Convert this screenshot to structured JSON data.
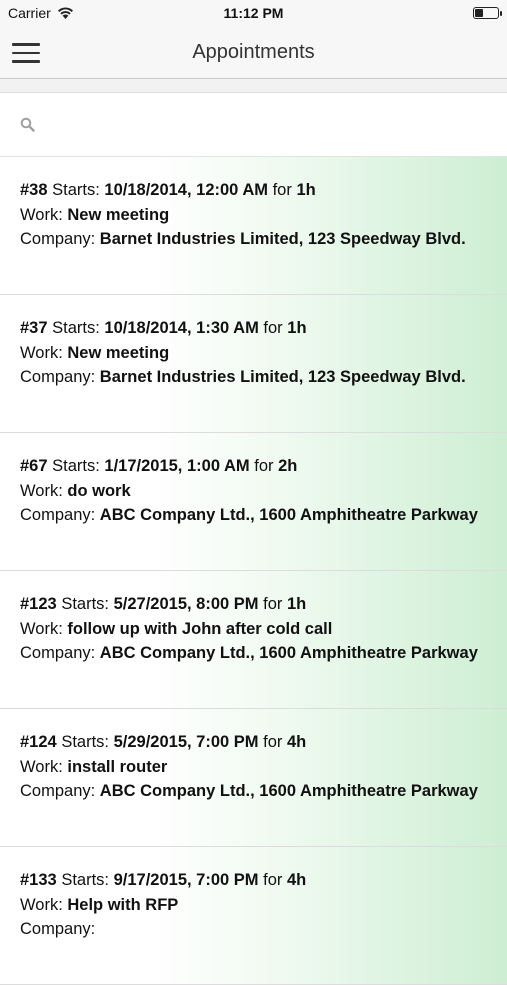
{
  "status_bar": {
    "carrier": "Carrier",
    "time": "11:12 PM",
    "battery_level": 0.35
  },
  "nav": {
    "title": "Appointments",
    "menu_icon": "hamburger-menu-icon"
  },
  "search": {
    "placeholder": "",
    "icon": "search-icon"
  },
  "labels": {
    "starts": "Starts:",
    "for": "for",
    "work": "Work:",
    "company": "Company:"
  },
  "appointments": [
    {
      "id": "#38",
      "start": "10/18/2014, 12:00 AM",
      "duration": "1h",
      "work": "New meeting",
      "company": "Barnet Industries Limited, 123 Speedway Blvd."
    },
    {
      "id": "#37",
      "start": "10/18/2014, 1:30 AM",
      "duration": "1h",
      "work": "New meeting",
      "company": "Barnet Industries Limited, 123 Speedway Blvd."
    },
    {
      "id": "#67",
      "start": "1/17/2015, 1:00 AM",
      "duration": "2h",
      "work": "do work",
      "company": "ABC Company Ltd., 1600 Amphitheatre Parkway"
    },
    {
      "id": "#123",
      "start": "5/27/2015, 8:00 PM",
      "duration": "1h",
      "work": "follow up with John after cold call",
      "company": "ABC Company Ltd., 1600 Amphitheatre Parkway"
    },
    {
      "id": "#124",
      "start": "5/29/2015, 7:00 PM",
      "duration": "4h",
      "work": "install router",
      "company": "ABC Company Ltd., 1600 Amphitheatre Parkway"
    },
    {
      "id": "#133",
      "start": "9/17/2015, 7:00 PM",
      "duration": "4h",
      "work": "Help with RFP",
      "company": ""
    }
  ]
}
